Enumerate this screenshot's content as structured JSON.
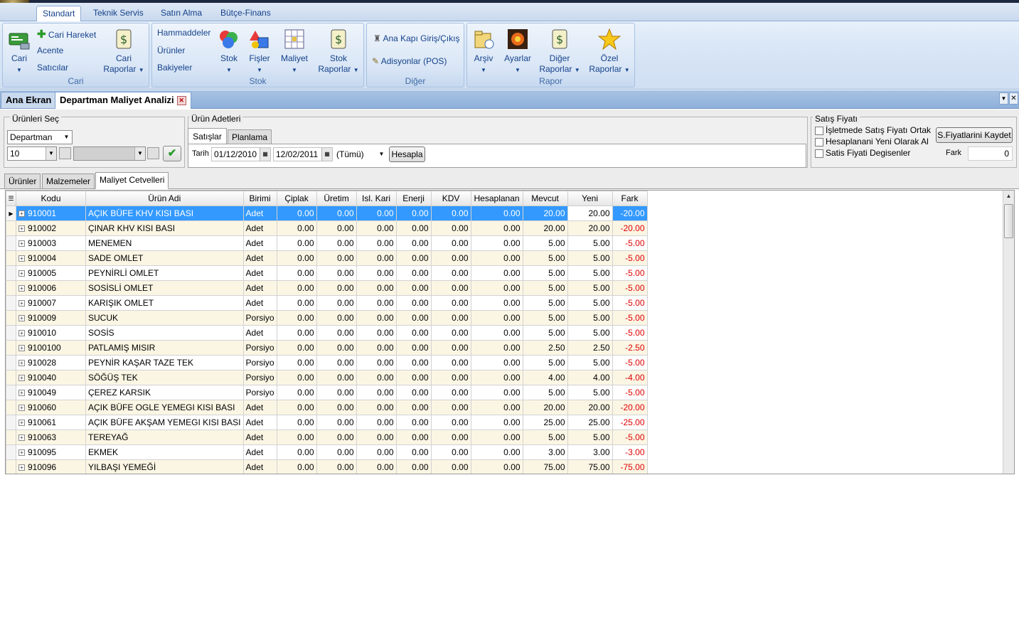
{
  "ribbon": {
    "tabs": [
      "Standart",
      "Teknik Servis",
      "Satın Alma",
      "Bütçe-Finans"
    ],
    "cari": {
      "big_cari": "Cari",
      "cari_hareket": "Cari Hareket",
      "acente": "Acente",
      "saticilar": "Satıcılar",
      "cari_raporlar_1": "Cari",
      "cari_raporlar_2": "Raporlar",
      "group_label": "Cari"
    },
    "stok": {
      "hammaddeler": "Hammaddeler",
      "urunler": "Ürünler",
      "bakiyeler": "Bakiyeler",
      "stok": "Stok",
      "fisler": "Fişler",
      "maliyet": "Maliyet",
      "stok_raporlar_1": "Stok",
      "stok_raporlar_2": "Raporlar",
      "group_label": "Stok"
    },
    "diger": {
      "ana_kapi": "Ana Kapı Giriş/Çıkış",
      "adisyonlar": "Adisyonlar (POS)",
      "group_label": "Diğer"
    },
    "rapor": {
      "arsiv": "Arşiv",
      "ayarlar": "Ayarlar",
      "diger_raporlar_1": "Diğer",
      "diger_raporlar_2": "Raporlar",
      "ozel_raporlar_1": "Özel",
      "ozel_raporlar_2": "Raporlar",
      "group_label": "Rapor"
    }
  },
  "doc_tabs": {
    "home": "Ana Ekran",
    "active": "Departman Maliyet Analizi"
  },
  "filters": {
    "urunleri_sec_label": "Ürünleri Seç",
    "departman": "Departman",
    "dept_value": "10",
    "urun_adetleri_label": "Ürün Adetleri",
    "tab_satislar": "Satışlar",
    "tab_planlama": "Planlama",
    "tarih_label": "Tarih",
    "date_from": "01/12/2010",
    "date_to": "12/02/2011",
    "tumu": "(Tümü)",
    "hesapla": "Hesapla",
    "satis_fiyati_label": "Satış Fiyatı",
    "chk1": "İşletmede Satış Fiyatı Ortak",
    "chk2": "Hesaplanani Yeni Olarak Al",
    "chk3": "Satis Fiyati Degisenler",
    "kaydet": "S.Fiyatlarini Kaydet",
    "fark_label": "Fark",
    "fark_value": "0"
  },
  "inner_tabs": [
    "Ürünler",
    "Malzemeler",
    "Maliyet Cetvelleri"
  ],
  "grid": {
    "columns": [
      "Kodu",
      "Ürün Adi",
      "Birimi",
      "Çiplak",
      "Üretim",
      "Isl. Kari",
      "Enerji",
      "KDV",
      "Hesaplanan",
      "Mevcut",
      "Yeni",
      "Fark"
    ],
    "rows": [
      [
        "910001",
        "AÇIK BÜFE KHV KISI BASI",
        "Adet",
        "0.00",
        "0.00",
        "0.00",
        "0.00",
        "0.00",
        "0.00",
        "20.00",
        "20.00",
        "-20.00"
      ],
      [
        "910002",
        "ÇINAR KHV KISI BASI",
        "Adet",
        "0.00",
        "0.00",
        "0.00",
        "0.00",
        "0.00",
        "0.00",
        "20.00",
        "20.00",
        "-20.00"
      ],
      [
        "910003",
        "MENEMEN",
        "Adet",
        "0.00",
        "0.00",
        "0.00",
        "0.00",
        "0.00",
        "0.00",
        "5.00",
        "5.00",
        "-5.00"
      ],
      [
        "910004",
        "SADE OMLET",
        "Adet",
        "0.00",
        "0.00",
        "0.00",
        "0.00",
        "0.00",
        "0.00",
        "5.00",
        "5.00",
        "-5.00"
      ],
      [
        "910005",
        "PEYNİRLİ OMLET",
        "Adet",
        "0.00",
        "0.00",
        "0.00",
        "0.00",
        "0.00",
        "0.00",
        "5.00",
        "5.00",
        "-5.00"
      ],
      [
        "910006",
        "SOSİSLİ OMLET",
        "Adet",
        "0.00",
        "0.00",
        "0.00",
        "0.00",
        "0.00",
        "0.00",
        "5.00",
        "5.00",
        "-5.00"
      ],
      [
        "910007",
        "KARIŞIK OMLET",
        "Adet",
        "0.00",
        "0.00",
        "0.00",
        "0.00",
        "0.00",
        "0.00",
        "5.00",
        "5.00",
        "-5.00"
      ],
      [
        "910009",
        "SUCUK",
        "Porsiyo",
        "0.00",
        "0.00",
        "0.00",
        "0.00",
        "0.00",
        "0.00",
        "5.00",
        "5.00",
        "-5.00"
      ],
      [
        "910010",
        "SOSİS",
        "Adet",
        "0.00",
        "0.00",
        "0.00",
        "0.00",
        "0.00",
        "0.00",
        "5.00",
        "5.00",
        "-5.00"
      ],
      [
        "9100100",
        "PATLAMIŞ MISIR",
        "Porsiyo",
        "0.00",
        "0.00",
        "0.00",
        "0.00",
        "0.00",
        "0.00",
        "2.50",
        "2.50",
        "-2.50"
      ],
      [
        "910028",
        "PEYNİR KAŞAR TAZE TEK",
        "Porsiyo",
        "0.00",
        "0.00",
        "0.00",
        "0.00",
        "0.00",
        "0.00",
        "5.00",
        "5.00",
        "-5.00"
      ],
      [
        "910040",
        "SÖĞÜŞ TEK",
        "Porsiyo",
        "0.00",
        "0.00",
        "0.00",
        "0.00",
        "0.00",
        "0.00",
        "4.00",
        "4.00",
        "-4.00"
      ],
      [
        "910049",
        "ÇEREZ KARSIK",
        "Porsiyo",
        "0.00",
        "0.00",
        "0.00",
        "0.00",
        "0.00",
        "0.00",
        "5.00",
        "5.00",
        "-5.00"
      ],
      [
        "910060",
        "AÇIK BÜFE OGLE YEMEGI KISI BASI",
        "Adet",
        "0.00",
        "0.00",
        "0.00",
        "0.00",
        "0.00",
        "0.00",
        "20.00",
        "20.00",
        "-20.00"
      ],
      [
        "910061",
        "AÇIK BÜFE AKŞAM YEMEGI KISI BASI",
        "Adet",
        "0.00",
        "0.00",
        "0.00",
        "0.00",
        "0.00",
        "0.00",
        "25.00",
        "25.00",
        "-25.00"
      ],
      [
        "910063",
        "TEREYAĞ",
        "Adet",
        "0.00",
        "0.00",
        "0.00",
        "0.00",
        "0.00",
        "0.00",
        "5.00",
        "5.00",
        "-5.00"
      ],
      [
        "910095",
        "EKMEK",
        "Adet",
        "0.00",
        "0.00",
        "0.00",
        "0.00",
        "0.00",
        "0.00",
        "3.00",
        "3.00",
        "-3.00"
      ],
      [
        "910096",
        "YILBAŞI YEMEĞİ",
        "Adet",
        "0.00",
        "0.00",
        "0.00",
        "0.00",
        "0.00",
        "0.00",
        "75.00",
        "75.00",
        "-75.00"
      ]
    ]
  }
}
